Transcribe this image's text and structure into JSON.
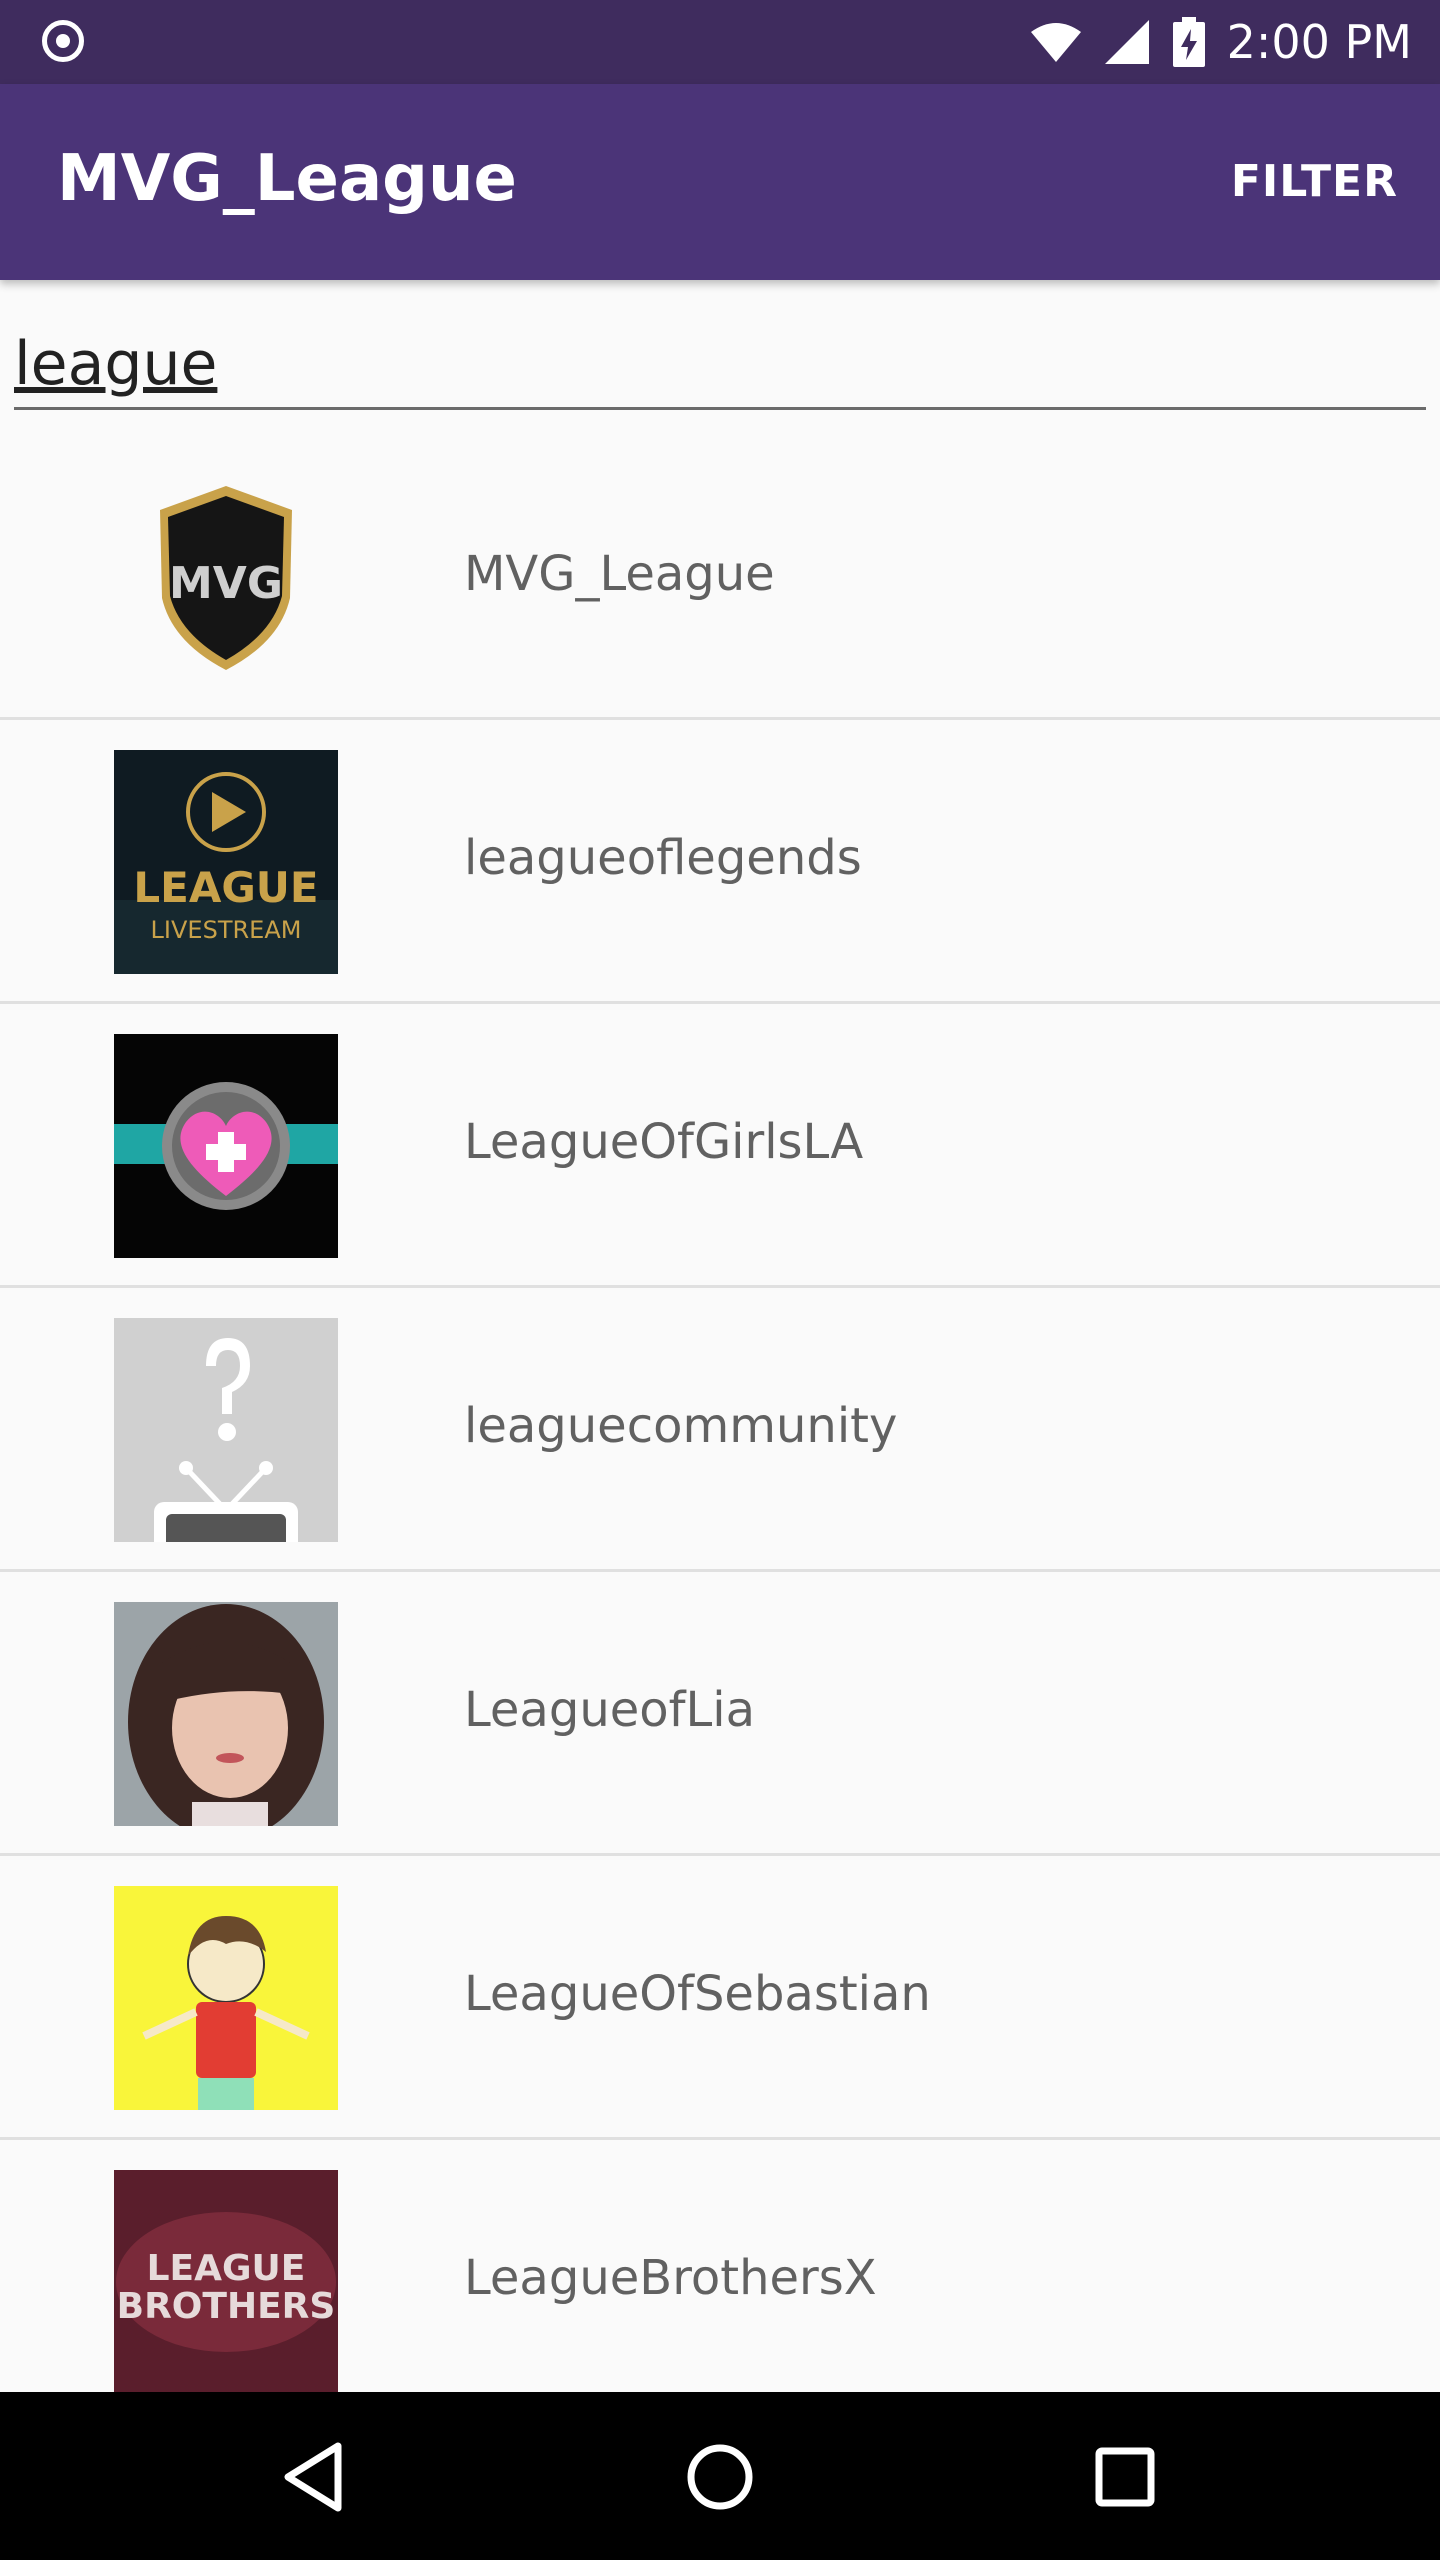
{
  "status_bar": {
    "time": "2:00 PM"
  },
  "app_bar": {
    "title": "MVG_League",
    "filter_label": "FILTER"
  },
  "search": {
    "value": "league"
  },
  "channels": [
    {
      "name": "MVG_League",
      "logo_text": "MVG"
    },
    {
      "name": "leagueoflegends",
      "logo_text": "LEAGUE",
      "logo_subtext": "LIVESTREAM"
    },
    {
      "name": "LeagueOfGirlsLA"
    },
    {
      "name": "leaguecommunity"
    },
    {
      "name": "LeagueofLia"
    },
    {
      "name": "LeagueOfSebastian"
    },
    {
      "name": "LeagueBrothersX",
      "logo_text": "LEAGUE",
      "logo_subtext": "BROTHERS"
    }
  ],
  "colors": {
    "status_bar": "#3f2c5e",
    "app_bar": "#4b3478",
    "background": "#fafafa",
    "nav_bar": "#000000"
  },
  "icons": {
    "status": [
      "record-icon",
      "wifi-icon",
      "signal-icon",
      "battery-charging-icon"
    ],
    "nav": [
      "back-icon",
      "home-icon",
      "recents-icon"
    ]
  }
}
